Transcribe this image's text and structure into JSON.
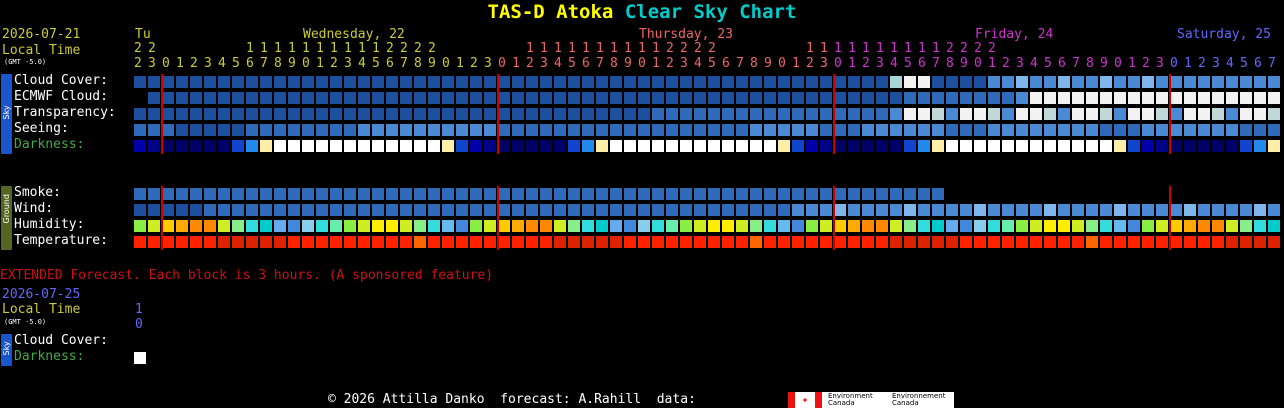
{
  "title": {
    "part1": "TAS-D Atoka",
    "part2": "Clear Sky Chart"
  },
  "colors": {
    "title_yellow": "#ffff00",
    "title_cyan": "#00cccc",
    "red_line": "#cc0000",
    "tue": "#cccc33",
    "wed": "#cccc33",
    "thu": "#ee6666",
    "fri": "#cc33cc",
    "sat": "#6666ff"
  },
  "header": {
    "date": "2026-07-21",
    "local_time": "Local Time",
    "gmt": "(GMT -5.0)",
    "days": [
      "Tu",
      "Wednesday, 22",
      "Thursday, 23",
      "Friday, 24",
      "Saturday, 25"
    ]
  },
  "hours_row1": "2 2       1 1 1 1 1 1 1 1 1 1 2 2 2 2       1 1 1 1 1 1 1 1 1 1 2 2 2 2       1 1 1 1 1 1 1 1 1 1 2 2 2 2",
  "hours_row2": "2 3 0 1 2 3 4 5 6 7 8 9 0 1 2 3 4 5 6 7 8 9 0 1 2 3 0 1 2 3 4 5 6 7 8 9 0 1 2 3 4 5 6 7 8 9 0 1 2 3 0 1 2 3 4 5 6 7 8 9 0 1 2 3 4 5 6 7 8 9 0 1 2 3 0 1 2 3 4 5 6 7",
  "sky_label": "Sky",
  "ground_label": "Ground",
  "rows": {
    "cloud": "Cloud Cover:",
    "ecmwf": "ECMWF Cloud:",
    "transparency": "Transparency:",
    "seeing": "Seeing:",
    "darkness": "Darkness:",
    "smoke": "Smoke:",
    "wind": "Wind:",
    "humidity": "Humidity:",
    "temperature": "Temperature:"
  },
  "extended": {
    "note": "EXTENDED Forecast. Each block is 3 hours. (A sponsored feature)",
    "date": "2026-07-25",
    "local_time": "Local Time",
    "gmt": "(GMT -5.0)",
    "hour_top": "1",
    "hour_bottom": "0",
    "cloud": "Cloud Cover:",
    "darkness": "Darkness:"
  },
  "footer": {
    "text": "© 2026 Attilla Danko  forecast: A.Rahill  data:",
    "env_en1": "Environment",
    "env_en2": "Canada",
    "env_fr1": "Environnement",
    "env_fr2": "Canada"
  }
}
